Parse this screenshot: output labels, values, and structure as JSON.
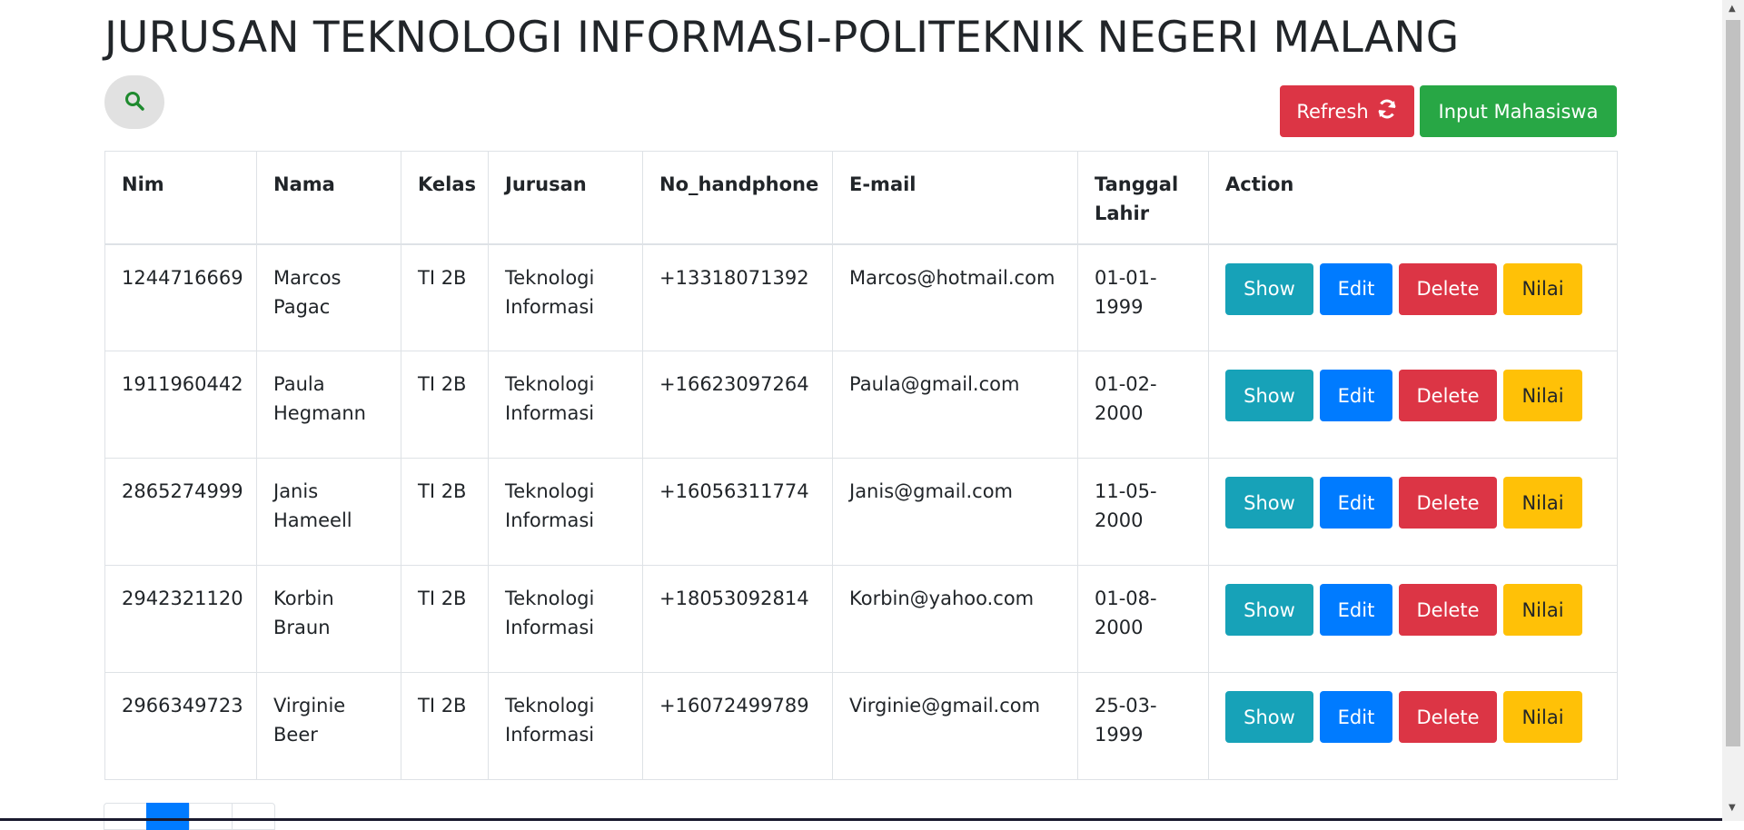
{
  "header": {
    "title": "JURUSAN TEKNOLOGI INFORMASI-POLITEKNIK NEGERI MALANG"
  },
  "toolbar": {
    "search_icon": "search-icon",
    "refresh_label": "Refresh",
    "refresh_icon": "refresh-icon",
    "input_label": "Input Mahasiswa",
    "colors": {
      "refresh": "#dc3545",
      "input": "#28a745",
      "search_icon": "#1e8a2e"
    }
  },
  "table": {
    "columns": [
      "Nim",
      "Nama",
      "Kelas",
      "Jurusan",
      "No_handphone",
      "E-mail",
      "Tanggal Lahir",
      "Action"
    ],
    "rows": [
      {
        "nim": "1244716669",
        "nama": "Marcos Pagac",
        "kelas": "TI 2B",
        "jurusan": "Teknologi Informasi",
        "no_handphone": "+13318071392",
        "email": "Marcos@hotmail.com",
        "tanggal_lahir": "01-01-1999"
      },
      {
        "nim": "1911960442",
        "nama": "Paula Hegmann",
        "kelas": "TI 2B",
        "jurusan": "Teknologi Informasi",
        "no_handphone": "+16623097264",
        "email": "Paula@gmail.com",
        "tanggal_lahir": "01-02-2000"
      },
      {
        "nim": "2865274999",
        "nama": "Janis Hameell",
        "kelas": "TI 2B",
        "jurusan": "Teknologi Informasi",
        "no_handphone": "+16056311774",
        "email": "Janis@gmail.com",
        "tanggal_lahir": "11-05-2000"
      },
      {
        "nim": "2942321120",
        "nama": "Korbin Braun",
        "kelas": "TI 2B",
        "jurusan": "Teknologi Informasi",
        "no_handphone": "+18053092814",
        "email": "Korbin@yahoo.com",
        "tanggal_lahir": "01-08-2000"
      },
      {
        "nim": "2966349723",
        "nama": "Virginie Beer",
        "kelas": "TI 2B",
        "jurusan": "Teknologi Informasi",
        "no_handphone": "+16072499789",
        "email": "Virginie@gmail.com",
        "tanggal_lahir": "25-03-1999"
      }
    ],
    "actions": {
      "show": "Show",
      "edit": "Edit",
      "delete": "Delete",
      "nilai": "Nilai",
      "colors": {
        "show": "#17a2b8",
        "edit": "#007bff",
        "delete": "#dc3545",
        "nilai": "#ffc107"
      }
    }
  },
  "pagination": {
    "active_color": "#007bff"
  }
}
